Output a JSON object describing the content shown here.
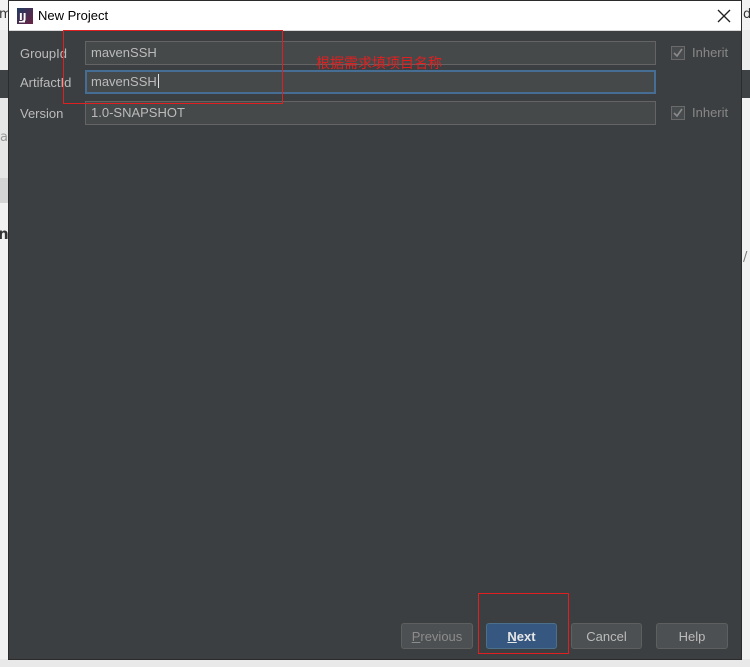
{
  "window": {
    "title": "New Project"
  },
  "background_peek": {
    "left_top_glyph": "m",
    "right_top_glyph": "d",
    "left_mid_glyph": "a",
    "left_bold_glyph": "n",
    "right_mid_glyph": "/"
  },
  "form": {
    "group_id": {
      "label": "GroupId",
      "value": "mavenSSH",
      "inherit_label": "Inherit",
      "inherit_checked": true
    },
    "artifact_id": {
      "label": "ArtifactId",
      "value": "mavenSSH"
    },
    "version": {
      "label": "Version",
      "value": "1.0-SNAPSHOT",
      "inherit_label": "Inherit",
      "inherit_checked": true
    }
  },
  "annotation": {
    "text": "根据需求填项目名称",
    "color": "#e02020"
  },
  "buttons": {
    "previous": {
      "mnemonic": "P",
      "rest": "revious"
    },
    "next": {
      "mnemonic": "N",
      "rest": "ext"
    },
    "cancel": "Cancel",
    "help": "Help"
  },
  "colors": {
    "dialog_bg": "#3c3f41",
    "field_bg": "#45494a",
    "focus_border": "#466d94",
    "next_button": "#365880"
  }
}
